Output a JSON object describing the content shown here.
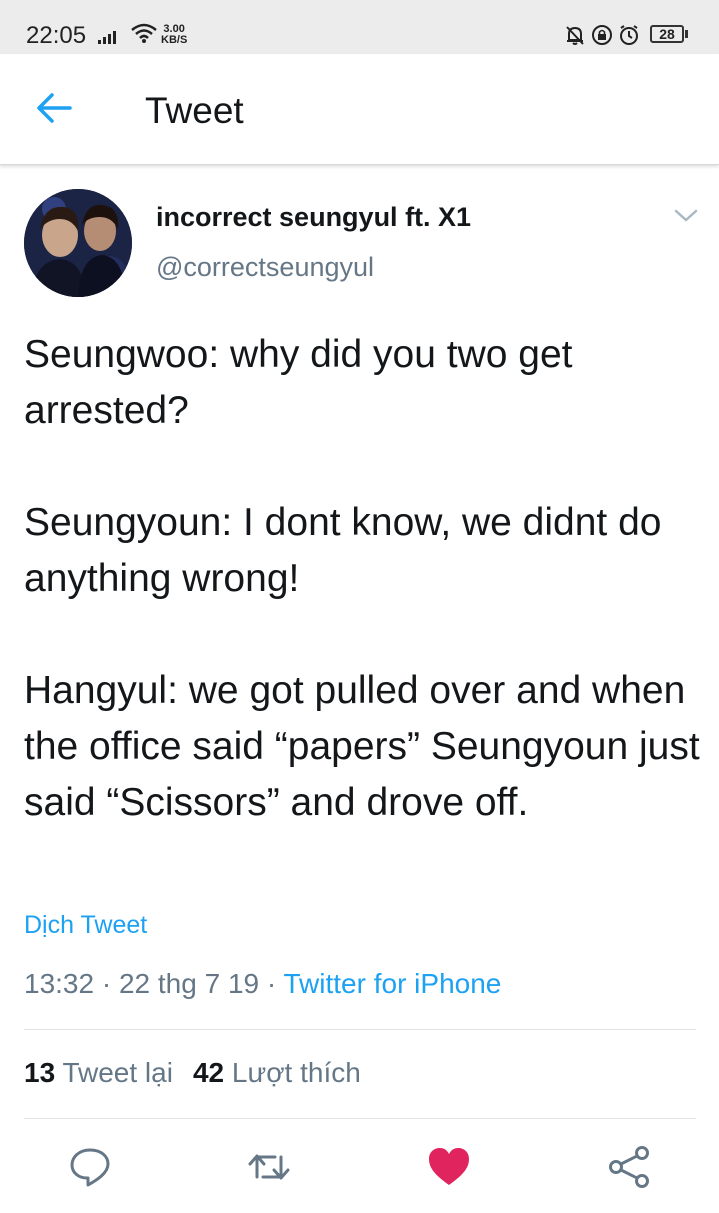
{
  "status_bar": {
    "time": "22:05",
    "speed_value": "3.00",
    "speed_unit": "KB/S",
    "battery": "28"
  },
  "header": {
    "title": "Tweet",
    "back_icon": "arrow-left-icon"
  },
  "tweet": {
    "display_name": "incorrect seungyul ft. X1",
    "handle": "@correctseungyul",
    "text": "Seungwoo: why did you two get arrested?\n\nSeungyoun: I dont know, we didnt do anything wrong!\n\nHangyul: we got pulled over and when the office said “papers” Seungyoun just said “Scissors” and drove off.",
    "translate_label": "Dịch Tweet",
    "time": "13:32",
    "date": "22 thg 7 19",
    "source": "Twitter for iPhone",
    "retweet_count": "13",
    "retweet_label": "Tweet lại",
    "like_count": "42",
    "like_label": "Lượt thích"
  },
  "actions": {
    "reply_icon": "reply-icon",
    "retweet_icon": "retweet-icon",
    "like_icon": "heart-icon",
    "share_icon": "share-icon"
  },
  "colors": {
    "accent": "#1da1f2",
    "like": "#e0245e",
    "secondary_text": "#657786"
  }
}
